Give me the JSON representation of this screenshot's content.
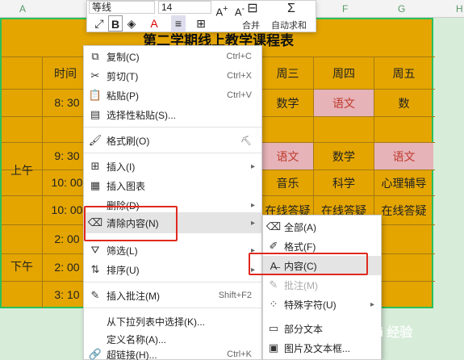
{
  "columns": [
    "A",
    "F",
    "G",
    "H"
  ],
  "table": {
    "title": "第二学期线上教学课程表",
    "header_time": "时间",
    "days": [
      "周三",
      "周四",
      "周五"
    ],
    "morning_label": "上午",
    "afternoon_label": "下午",
    "times": [
      "8: 30",
      "9: 30",
      "10: 00",
      "10: 00",
      "2: 00",
      "2: 00",
      "3: 10"
    ],
    "rows": [
      [
        "数学",
        "语文",
        "数"
      ],
      [
        "",
        "",
        ""
      ],
      [
        "语文",
        "数学",
        "语文"
      ],
      [
        "音乐",
        "科学",
        "心理辅导"
      ],
      [
        "在线答疑",
        "在线答疑",
        "在线答疑"
      ]
    ]
  },
  "toolbar": {
    "font": "等线",
    "size": "14",
    "merge": "合并",
    "autosum": "自动求和"
  },
  "context_menu": [
    {
      "label": "复制(C)",
      "shortcut": "Ctrl+C",
      "icon": "copy-icon"
    },
    {
      "label": "剪切(T)",
      "shortcut": "Ctrl+X",
      "icon": "cut-icon"
    },
    {
      "label": "粘贴(P)",
      "shortcut": "Ctrl+V",
      "icon": "paste-icon"
    },
    {
      "label": "选择性粘贴(S)...",
      "shortcut": "",
      "icon": "paste-special-icon"
    },
    {
      "label": "格式刷(O)",
      "shortcut": "",
      "icon": "format-painter-icon"
    },
    {
      "label": "插入(I)",
      "shortcut": "",
      "icon": "insert-icon"
    },
    {
      "label": "插入图表",
      "shortcut": "",
      "icon": "chart-icon"
    },
    {
      "label": "删除(D)",
      "shortcut": "",
      "icon": "delete-icon"
    },
    {
      "label": "清除内容(N)",
      "shortcut": "",
      "icon": "clear-icon"
    },
    {
      "label": "筛选(L)",
      "shortcut": "",
      "icon": "filter-icon"
    },
    {
      "label": "排序(U)",
      "shortcut": "",
      "icon": "sort-icon"
    },
    {
      "label": "插入批注(M)",
      "shortcut": "Shift+F2",
      "icon": "comment-icon"
    },
    {
      "label": "从下拉列表中选择(K)...",
      "shortcut": "",
      "icon": ""
    },
    {
      "label": "定义名称(A)...",
      "shortcut": "",
      "icon": ""
    },
    {
      "label": "超链接(H)...",
      "shortcut": "Ctrl+K",
      "icon": "link-icon"
    }
  ],
  "submenu": [
    {
      "label": "全部(A)",
      "icon": "clear-all-icon"
    },
    {
      "label": "格式(F)",
      "icon": "clear-format-icon"
    },
    {
      "label": "内容(C)",
      "icon": "clear-content-icon"
    },
    {
      "label": "批注(M)",
      "icon": "clear-comment-icon"
    },
    {
      "label": "特殊字符(U)",
      "icon": "special-char-icon"
    },
    {
      "label": "部分文本",
      "icon": "partial-text-icon"
    },
    {
      "label": "图片及文本框...",
      "icon": "image-textbox-icon"
    }
  ],
  "watermark": "Bai 经验"
}
